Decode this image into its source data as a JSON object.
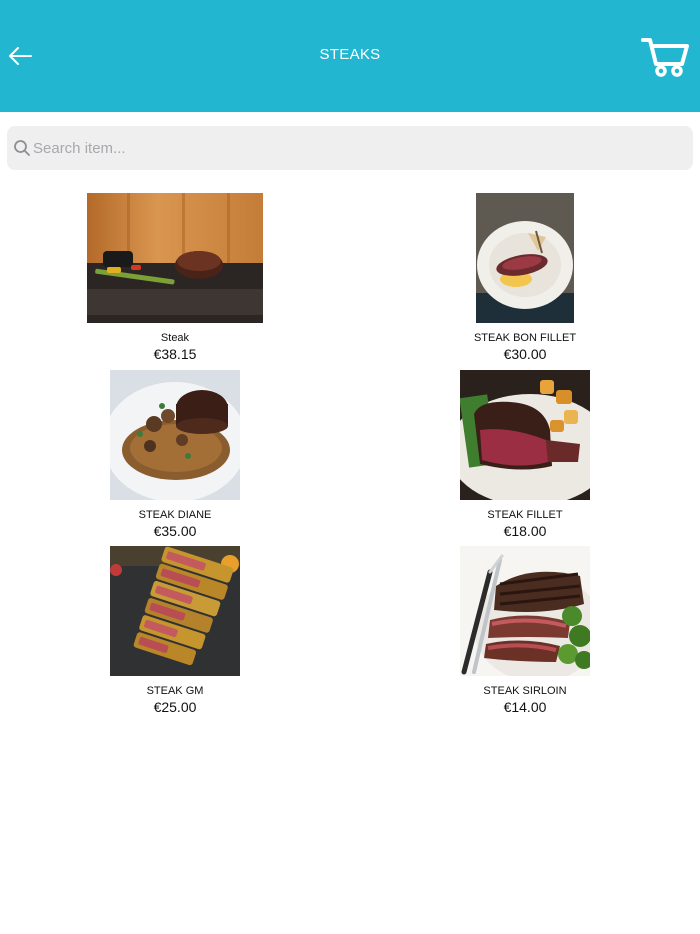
{
  "header": {
    "title": "STEAKS",
    "background": "#22b6d1",
    "back_icon": "arrow-left-icon",
    "cart_icon": "cart-icon"
  },
  "search": {
    "placeholder": "Search item..."
  },
  "products": [
    {
      "name": "Steak",
      "price": "€38.15"
    },
    {
      "name": "STEAK BON FILLET",
      "price": "€30.00"
    },
    {
      "name": "STEAK DIANE",
      "price": "€35.00"
    },
    {
      "name": "STEAK FILLET",
      "price": "€18.00"
    },
    {
      "name": "STEAK GM",
      "price": "€25.00"
    },
    {
      "name": "STEAK SIRLOIN",
      "price": "€14.00"
    }
  ]
}
